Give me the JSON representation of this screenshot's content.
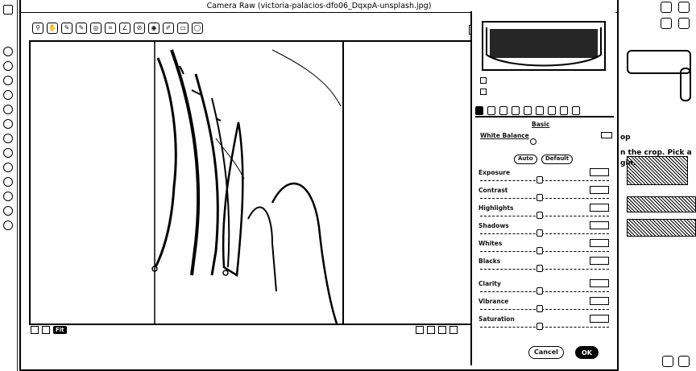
{
  "dialog": {
    "title": "Camera Raw (victoria-palacios-dfo06_DqxpA-unsplash.jpg)",
    "cancel_label": "Cancel",
    "ok_label": "OK"
  },
  "toolbar": {
    "tools": [
      "zoom-tool",
      "hand-tool",
      "white-balance-tool",
      "color-sampler-tool",
      "target-adjustment-tool",
      "crop-tool",
      "straighten-tool",
      "spot-removal-tool",
      "red-eye-tool",
      "adjustment-brush",
      "graduated-filter",
      "radial-filter"
    ]
  },
  "preview_footer": {
    "zoom_label": "Fit"
  },
  "panel": {
    "tabs": [
      "basic",
      "tone-curve",
      "detail",
      "hsl",
      "split-toning",
      "lens",
      "effects",
      "camera-calibration",
      "presets"
    ],
    "section_title": "Basic",
    "wb_label": "White Balance",
    "auto_label": "Auto",
    "default_label": "Default",
    "sliders": [
      {
        "name": "exposure",
        "label": "Exposure",
        "value": 0.45
      },
      {
        "name": "contrast",
        "label": "Contrast",
        "value": 0.45
      },
      {
        "name": "highlights",
        "label": "Highlights",
        "value": 0.45
      },
      {
        "name": "shadows",
        "label": "Shadows",
        "value": 0.45
      },
      {
        "name": "whites",
        "label": "Whites",
        "value": 0.45
      },
      {
        "name": "blacks",
        "label": "Blacks",
        "value": 0.45
      },
      {
        "name": "clarity",
        "label": "Clarity",
        "value": 0.45
      },
      {
        "name": "vibrance",
        "label": "Vibrance",
        "value": 0.45
      },
      {
        "name": "saturation",
        "label": "Saturation",
        "value": 0.45
      }
    ]
  },
  "background": {
    "side_text_1": "op",
    "side_text_2": "n the crop. Pick a",
    "side_text_3": "gin."
  }
}
